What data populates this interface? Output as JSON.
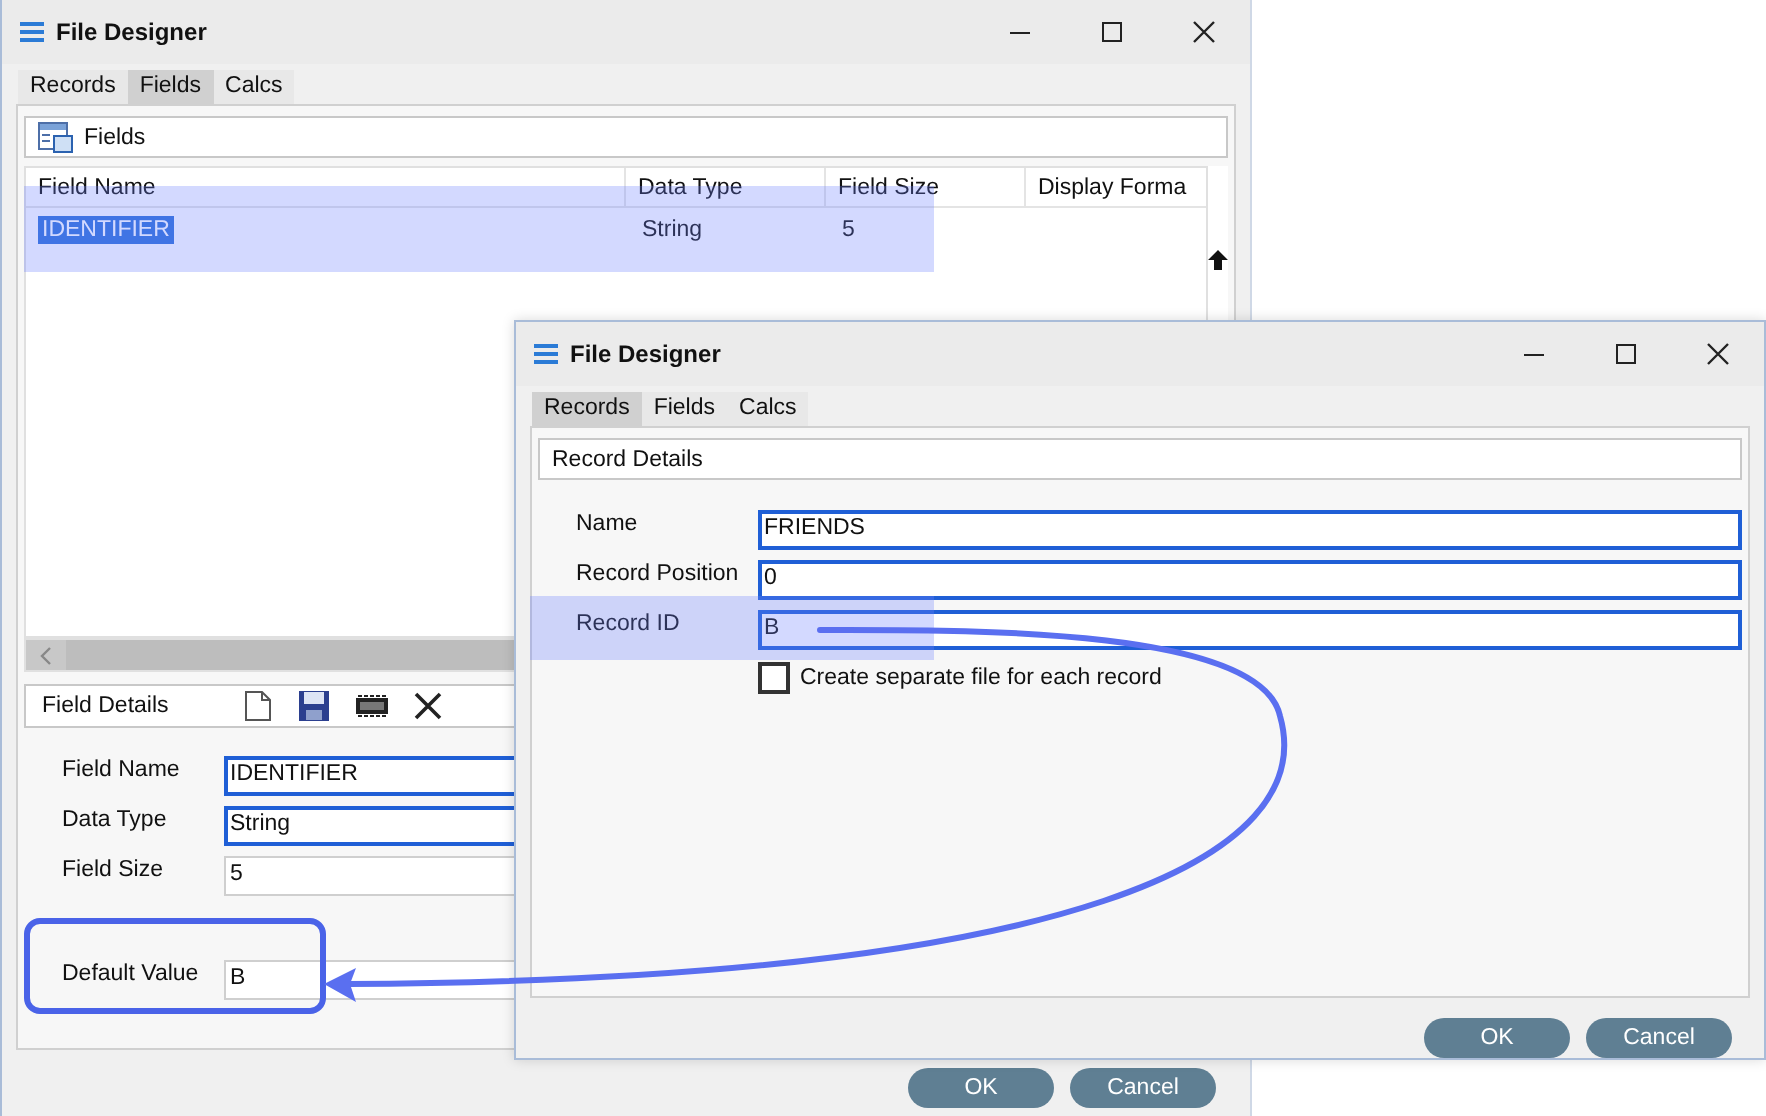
{
  "back_window": {
    "title": "File Designer",
    "tabs": [
      {
        "label": "Records",
        "selected": false
      },
      {
        "label": "Fields",
        "selected": true
      },
      {
        "label": "Calcs",
        "selected": false
      }
    ],
    "panel_title": "Fields",
    "grid": {
      "columns": [
        "Field Name",
        "Data Type",
        "Field Size",
        "Display Forma"
      ],
      "rows": [
        {
          "cells": [
            "IDENTIFIER",
            "String",
            "5"
          ],
          "selected": true
        }
      ]
    },
    "details_title": "Field Details",
    "fields": [
      {
        "label": "Field Name",
        "value": "IDENTIFIER",
        "focused": true
      },
      {
        "label": "Data Type",
        "value": "String",
        "focused": true
      },
      {
        "label": "Field Size",
        "value": "5",
        "focused": false
      },
      {
        "label": "Default Value",
        "value": "B",
        "focused": false
      }
    ],
    "buttons": [
      "OK",
      "Cancel"
    ]
  },
  "front_window": {
    "title": "File Designer",
    "tabs": [
      {
        "label": "Records",
        "selected": true
      },
      {
        "label": "Fields",
        "selected": false
      },
      {
        "label": "Calcs",
        "selected": false
      }
    ],
    "panel_title": "Record Details",
    "fields": [
      {
        "label": "Name",
        "value": "FRIENDS",
        "focused": true
      },
      {
        "label": "Record Position",
        "value": "0",
        "focused": true
      },
      {
        "label": "Record ID",
        "value": "B",
        "focused": true
      }
    ],
    "checkbox": {
      "label": "Create separate file for each record",
      "checked": false
    },
    "buttons": [
      "OK",
      "Cancel"
    ]
  }
}
